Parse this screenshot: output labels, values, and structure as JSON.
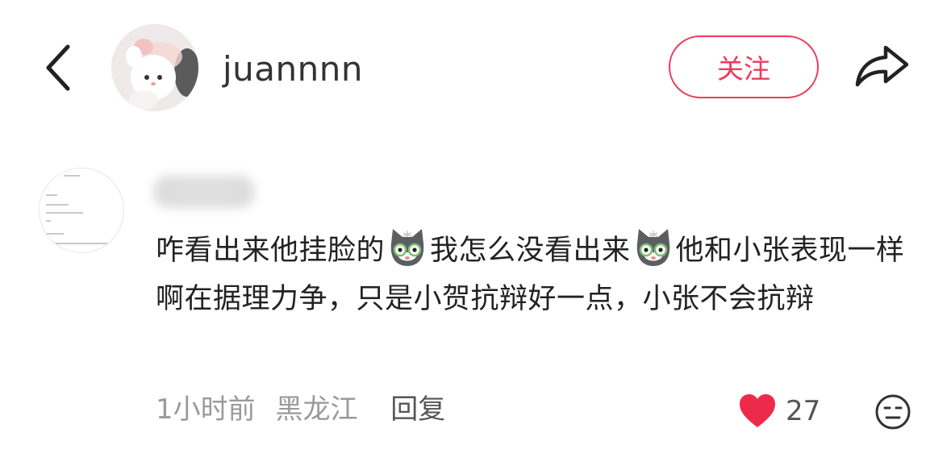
{
  "header": {
    "back_icon": "chevron-left-icon",
    "username": "juannnn",
    "follow_label": "关注",
    "share_icon": "share-arrow-icon",
    "accent_color": "#ee3b5a"
  },
  "comment": {
    "text_segments": [
      "咋看出来他挂脸的",
      "我怎么没看出来",
      "他和小张表现一样啊在据理力争，只是小贺抗辩好一点，小张不会抗辩"
    ],
    "emoji_icon": "cat-emoji-icon",
    "time": "1小时前",
    "location": "黑龙江",
    "reply_label": "回复",
    "like_count": "27",
    "like_color": "#ee2a4b"
  }
}
